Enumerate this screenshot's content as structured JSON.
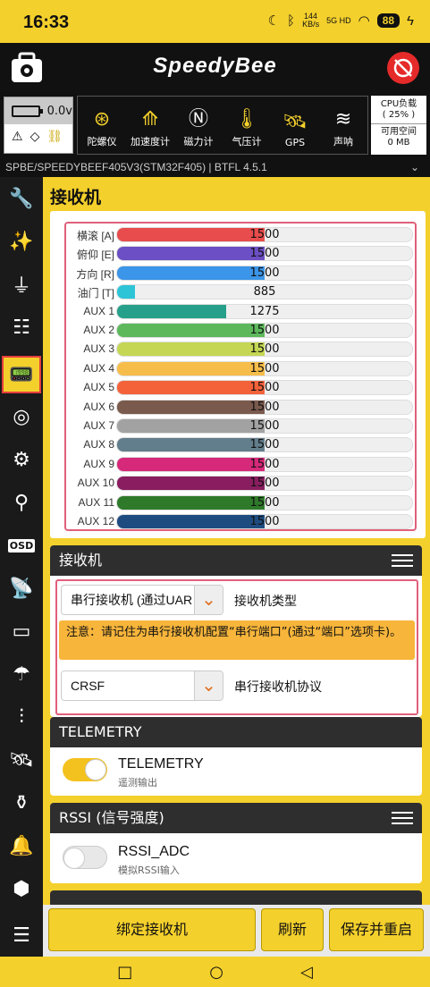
{
  "status": {
    "time": "16:33",
    "speed_top": "144",
    "speed_unit": "KB/s",
    "network": "5G HD",
    "battery": "88"
  },
  "brand": {
    "logo": "SpeedyBee"
  },
  "battery_box": {
    "voltage": "0.0v"
  },
  "sensors": [
    {
      "label": "陀螺仪",
      "icon": "gyro-icon"
    },
    {
      "label": "加速度计",
      "icon": "accel-icon"
    },
    {
      "label": "磁力计",
      "icon": "compass-icon"
    },
    {
      "label": "气压计",
      "icon": "barometer-icon"
    },
    {
      "label": "GPS",
      "icon": "gps-icon"
    },
    {
      "label": "声呐",
      "icon": "sonar-icon"
    }
  ],
  "cpu": {
    "load_label": "CPU负载",
    "load_value": "( 25% )",
    "space_label": "可用空间",
    "space_value": "0 MB"
  },
  "firmware": {
    "text": "SPBE/SPEEDYBEEF405V3(STM32F405)  |  BTFL 4.5.1"
  },
  "page": {
    "title": "接收机"
  },
  "channels": [
    {
      "label": "横滚 [A]",
      "value": "1500",
      "fraction": 0.5,
      "color": "#e84c4c"
    },
    {
      "label": "俯仰 [E]",
      "value": "1500",
      "fraction": 0.5,
      "color": "#6c4fc4"
    },
    {
      "label": "方向 [R]",
      "value": "1500",
      "fraction": 0.5,
      "color": "#3b95e8"
    },
    {
      "label": "油门 [T]",
      "value": "885",
      "fraction": 0.06,
      "color": "#2ec4d8"
    },
    {
      "label": "AUX 1",
      "value": "1275",
      "fraction": 0.37,
      "color": "#26a08a"
    },
    {
      "label": "AUX 2",
      "value": "1500",
      "fraction": 0.5,
      "color": "#5db85c"
    },
    {
      "label": "AUX 3",
      "value": "1500",
      "fraction": 0.5,
      "color": "#c5d654"
    },
    {
      "label": "AUX 4",
      "value": "1500",
      "fraction": 0.5,
      "color": "#f7bd4a"
    },
    {
      "label": "AUX 5",
      "value": "1500",
      "fraction": 0.5,
      "color": "#f4623a"
    },
    {
      "label": "AUX 6",
      "value": "1500",
      "fraction": 0.5,
      "color": "#7a5a4d"
    },
    {
      "label": "AUX 7",
      "value": "1500",
      "fraction": 0.5,
      "color": "#a2a2a2"
    },
    {
      "label": "AUX 8",
      "value": "1500",
      "fraction": 0.5,
      "color": "#627d8b"
    },
    {
      "label": "AUX 9",
      "value": "1500",
      "fraction": 0.5,
      "color": "#d6297a"
    },
    {
      "label": "AUX 10",
      "value": "1500",
      "fraction": 0.5,
      "color": "#891d60"
    },
    {
      "label": "AUX 11",
      "value": "1500",
      "fraction": 0.5,
      "color": "#2e7a2a"
    },
    {
      "label": "AUX 12",
      "value": "1500",
      "fraction": 0.5,
      "color": "#1e4c80"
    }
  ],
  "receiver": {
    "header": "接收机",
    "type_value": "串行接收机 (通过UAR",
    "type_label": "接收机类型",
    "notice": "注意：请记住为串行接收机配置“串行端口”(通过“端口”选项卡)。",
    "protocol_value": "CRSF",
    "protocol_label": "串行接收机协议"
  },
  "telemetry": {
    "header": "TELEMETRY",
    "title": "TELEMETRY",
    "subtitle": "遥测输出",
    "on": true
  },
  "rssi": {
    "header": "RSSI (信号强度)",
    "title": "RSSI_ADC",
    "subtitle": "模拟RSSI输入",
    "on": false
  },
  "actions": {
    "bind": "绑定接收机",
    "refresh": "刷新",
    "save": "保存并重启"
  }
}
